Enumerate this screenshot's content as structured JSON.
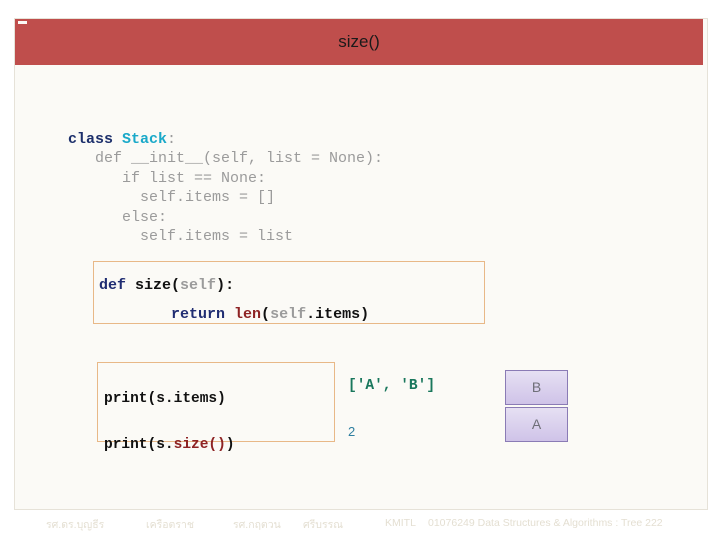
{
  "slide": {
    "title": "size()",
    "accent_color": "#bf4e4c",
    "panel_color": "#fbfaf6"
  },
  "code_main": {
    "lines": [
      {
        "segments": [
          {
            "text": "class ",
            "style": "kw-class"
          },
          {
            "text": "Stack",
            "style": "cls-name"
          },
          {
            "text": ":",
            "style": "punc-dim"
          }
        ]
      },
      {
        "segments": [
          {
            "text": "   def __init__(self, list = None):",
            "style": "punc-dim"
          }
        ]
      },
      {
        "segments": [
          {
            "text": "      if list == None:",
            "style": "punc-dim"
          }
        ]
      },
      {
        "segments": [
          {
            "text": "        self.items = []",
            "style": "punc-dim"
          }
        ]
      },
      {
        "segments": [
          {
            "text": "      else:",
            "style": "punc-dim"
          }
        ]
      },
      {
        "segments": [
          {
            "text": "        self.items = list",
            "style": "punc-dim"
          }
        ]
      }
    ]
  },
  "code_size_box": {
    "line1": [
      {
        "text": "def ",
        "style": "kw-def"
      },
      {
        "text": "size",
        "style": "fn-black"
      },
      {
        "text": "(",
        "style": "fn-black"
      },
      {
        "text": "self",
        "style": "arg-gray"
      },
      {
        "text": "):",
        "style": "fn-black"
      }
    ],
    "line2": [
      {
        "text": "        ",
        "style": "fn-black"
      },
      {
        "text": "return ",
        "style": "kw-return"
      },
      {
        "text": "len",
        "style": "builtin"
      },
      {
        "text": "(",
        "style": "fn-black"
      },
      {
        "text": "self",
        "style": "arg-gray"
      },
      {
        "text": ".items",
        "style": "fn-black"
      },
      {
        "text": ")",
        "style": "fn-black"
      }
    ]
  },
  "code_print_box": {
    "line1": [
      {
        "text": "print(s.items)",
        "style": "fn-black"
      }
    ],
    "line2": [
      {
        "text": "print(s.",
        "style": "fn-black"
      },
      {
        "text": "size()",
        "style": "meth-red"
      },
      {
        "text": ")",
        "style": "fn-black"
      }
    ]
  },
  "output": {
    "items_result": "['A', 'B']",
    "size_result": "2",
    "items_color": "#19775c",
    "size_color": "#2f7fa0"
  },
  "stack": {
    "cells": [
      {
        "label": "B"
      },
      {
        "label": "A"
      }
    ],
    "fill_color": "#cfc3e8",
    "border_color": "#8a7bb5"
  },
  "footer": {
    "author1": "รศ.ดร.บุญธีร",
    "author1b": "เครือตราช",
    "author2": "รศ.กฤตวน",
    "author2b": "ศรีบรรณ",
    "institution": "KMITL",
    "course": "01076249 Data Structures & Algorithms : Tree 222"
  }
}
